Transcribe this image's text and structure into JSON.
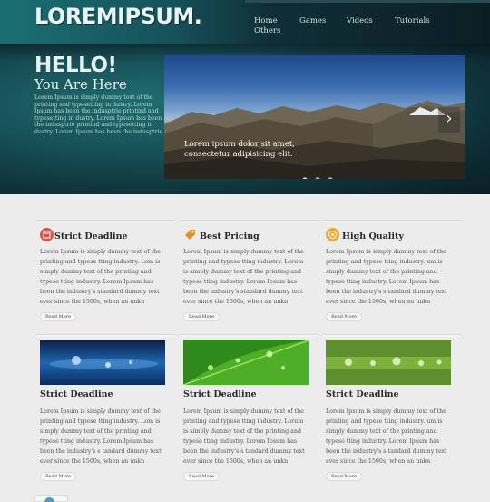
{
  "header": {
    "logo": "LOREMIPSUM.",
    "nav": [
      "Home",
      "Games",
      "Videos",
      "Tutorials",
      "Others"
    ]
  },
  "hero": {
    "title": "HELLO!",
    "subtitle": "You Are Here",
    "intro": "Lorem Ipsum is simply dummy text of the printing and typesetting in dustry. Lorem Ipsum has been the indusptrie printind and typesetting in dustry. Lorem Ipsum has been the indusptrie printind and typesetting in dustry. Lorem Ipsum has been the indusptrie",
    "slider": {
      "caption": "Lorem ipsum dolor sit amet, consectetur adipisicing elit.",
      "next_glyph": "›",
      "active_slide": 1,
      "slide_count": 3
    }
  },
  "features": [
    {
      "title": "Strict Deadline",
      "icon": "calendar-icon",
      "color": "#d9534f",
      "text": "Lorem Ipsum is simply dummy text of the printing and typese tting industry. Lom is simply dummy text of the printing and typese tting industry. Lorem Ipsum has been the industry's standard dummy text ever since the 1500s, when an unkn",
      "read_more": "Read More"
    },
    {
      "title": "Best Pricing",
      "icon": "tag-icon",
      "color": "#e8902a",
      "text": "Lorem Ipsum is simply dummy text of the printing and typese tting industry. Lorum is simply dummy text of the printing and typese tting industry. Lorem Ipsum has been the industry's standard dummy text ever since the 1500s, when an unkn",
      "read_more": "Read More"
    },
    {
      "title": "High Quality",
      "icon": "badge-icon",
      "color": "#f0a93b",
      "text": "Lorem Ipsum is simply dummy text of the printing and typese tting industry. um is simply dummy text of the printing and typese tting industry. Lorem Ipsum has been the industry's s tandard dummy text ever since the 1500s, when an unkn",
      "read_more": "Read More"
    }
  ],
  "gallery": [
    {
      "title": "Strict Deadline",
      "image": "water-drop-blue",
      "text": "Lorem Ipsum is simply dummy text of the printing and typese tting industry. Lom is simply dummy text of the printing and typese tting industry. Lorem Ipsum has been the industry's s tandard dummy text ever since the 1500s, when an unkn",
      "read_more": "Read More"
    },
    {
      "title": "Strict Deadline",
      "image": "green-leaf-drops",
      "text": "Lorem Ipsum is simply dummy text of the printing and typese tting industry. Lorum is simply dummy text of the printing and typese tting industry. Lorem Ipsum has been the industry's s tandard dummy text ever since the 1500s, when an unkn",
      "read_more": "Read More"
    },
    {
      "title": "Strict Deadline",
      "image": "green-grass-drops",
      "text": "Lorem Ipsum is simply dummy text of the printing and typese tting industry. um is simply dummy text of the printing and typese tting industry. Lorem Ipsum has been the industry's s tandard dummy text ever since the 1500s, when an unkn",
      "read_more": "Read More"
    }
  ]
}
